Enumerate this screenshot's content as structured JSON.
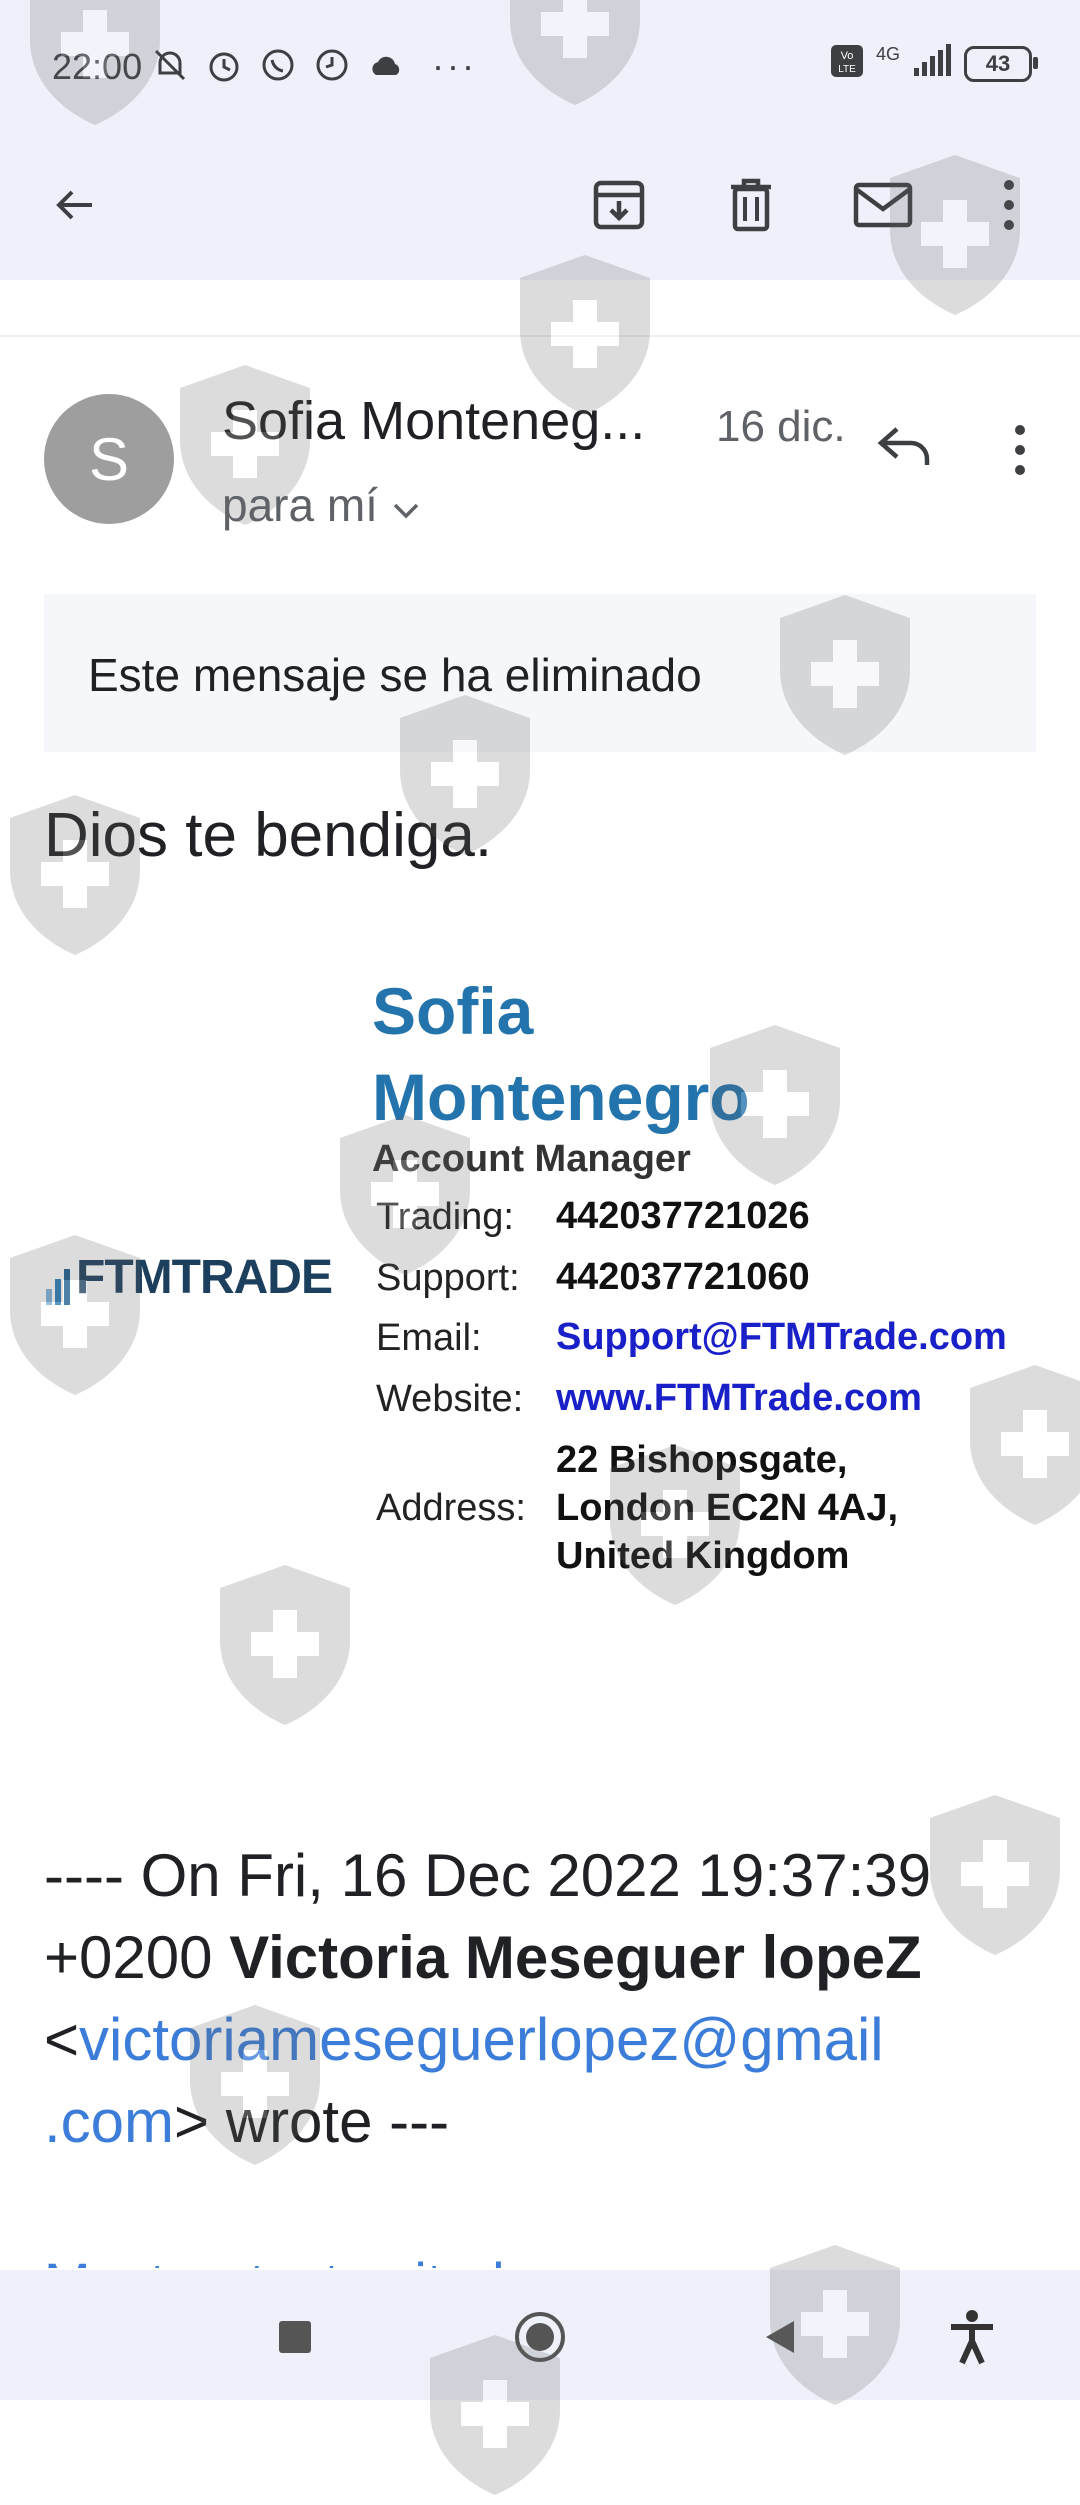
{
  "status_bar": {
    "time": "22:00",
    "network": "4G",
    "battery": "43",
    "more": "···",
    "icons": [
      "mute-icon",
      "alarm-icon",
      "whatsapp-icon",
      "clock-icon",
      "cloud-icon",
      "volte-icon",
      "signal-icon",
      "battery-icon"
    ]
  },
  "toolbar": {
    "icons": [
      "back-arrow-icon",
      "archive-icon",
      "trash-icon",
      "mark-unread-icon",
      "more-vert-icon"
    ]
  },
  "message": {
    "avatar_letter": "S",
    "sender": "Sofia Monteneg...",
    "date": "16 dic.",
    "recipient": "para mí",
    "deleted_notice": "Este mensaje se ha eliminado",
    "greeting": "Dios te bendiga."
  },
  "signature": {
    "logo_text": "FTMTRADE",
    "name_line1": "Sofia",
    "name_line2": "Montenegro",
    "role": "Account Manager",
    "rows": [
      {
        "label": "Trading:",
        "value": "442037721026"
      },
      {
        "label": "Support:",
        "value": "442037721060"
      },
      {
        "label": "Email:",
        "value": "Support@FTMTrade.com"
      },
      {
        "label": "Website:",
        "value": "www.FTMTrade.com"
      },
      {
        "label": "Address:",
        "value_lines": [
          "22 Bishopsgate,",
          "London EC2N 4AJ,",
          "United Kingdom"
        ]
      }
    ],
    "colors": {
      "name": "#2374ad",
      "link": "#1a20c8"
    }
  },
  "quote": {
    "prefix": "---- On Fri, 16 Dec 2022 19:37:39 +0200",
    "author": "Victoria Meseguer lopeZ",
    "open_bracket": "<",
    "email_part1": "victoriameseguerlopez@gmail",
    "email_part2": ".com",
    "close_bracket": ">",
    "suffix": "wrote ---",
    "show_quoted": "Mostrar texto citado"
  },
  "navigation_bar": {
    "icons": [
      "recents-square-icon",
      "home-circle-icon",
      "back-triangle-icon",
      "accessibility-icon"
    ]
  },
  "colors": {
    "surface": "#eef1f9",
    "link": "#3b7dd8",
    "avatar": "#9e9e9e"
  }
}
